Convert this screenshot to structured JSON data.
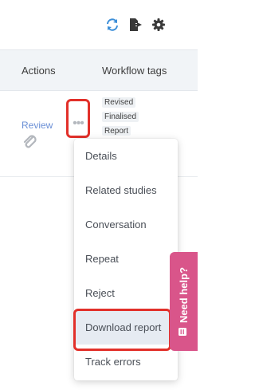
{
  "toolbar": {
    "icons": [
      "refresh-icon",
      "export-icon",
      "gear-icon"
    ],
    "refresh_color": "#3d8fd8",
    "icon_color": "#3a3a3a"
  },
  "table": {
    "columns": [
      "Actions",
      "Workflow tags"
    ],
    "row": {
      "action_link": "Review",
      "tags": [
        "Revised",
        "Finalised",
        "Report"
      ]
    }
  },
  "menu": {
    "items": [
      "Details",
      "Related studies",
      "Conversation",
      "Repeat",
      "Reject",
      "Download report",
      "Track errors"
    ],
    "selected": "Download report"
  },
  "help_tab": {
    "label": "Need help?",
    "color": "#d9558a"
  },
  "highlight_color": "#e2302a"
}
